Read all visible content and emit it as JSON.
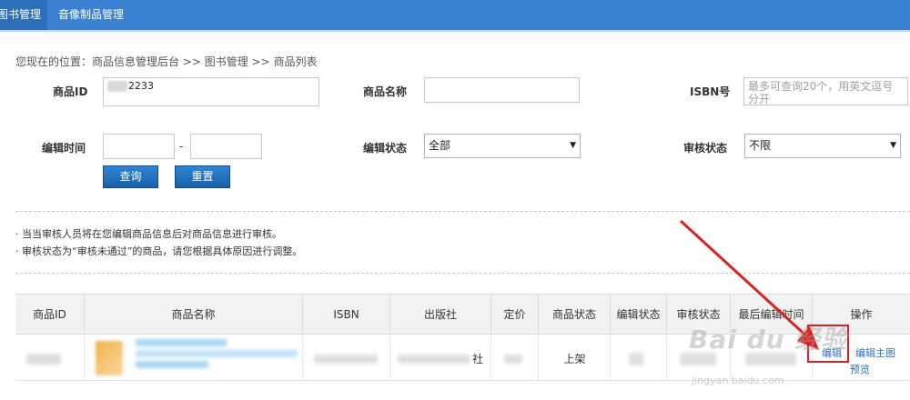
{
  "nav": {
    "tabs": [
      {
        "label": "图书管理",
        "active": true
      },
      {
        "label": "音像制品管理",
        "active": false
      }
    ],
    "color": "#3b82d2"
  },
  "breadcrumb": "您现在的位置：商品信息管理后台 >>  图书管理 >> 商品列表",
  "form": {
    "product_id_label": "商品ID",
    "product_id_value": "2233",
    "product_name_label": "商品名称",
    "product_name_value": "",
    "isbn_label": "ISBN号",
    "isbn_placeholder": "最多可查询20个，用英文逗号分开",
    "edit_time_label": "编辑时间",
    "time_separator": "-",
    "edit_status_label": "编辑状态",
    "edit_status_value": "全部",
    "audit_status_label": "审核状态",
    "audit_status_value": "不限",
    "query_button": "查询",
    "reset_button": "重置"
  },
  "tips": [
    "· 当当审核人员将在您编辑商品信息后对商品信息进行审核。",
    "· 审核状态为“审核未通过”的商品，请您根据具体原因进行调整。"
  ],
  "table": {
    "headers": [
      "商品ID",
      "商品名称",
      "ISBN",
      "出版社",
      "定价",
      "商品状态",
      "编辑状态",
      "审核状态",
      "最后编辑时间",
      "操作"
    ],
    "rows": [
      {
        "publisher_suffix": "社",
        "product_status": "上架",
        "actions": [
          "编辑",
          "编辑主图",
          "预览"
        ]
      }
    ]
  },
  "watermark": {
    "brand": "Bai du 经验",
    "url": "jingyan.baidu.com"
  },
  "colors": {
    "button": "#1a5fa8",
    "highlight": "#e02020",
    "link": "#2a6fc0"
  }
}
